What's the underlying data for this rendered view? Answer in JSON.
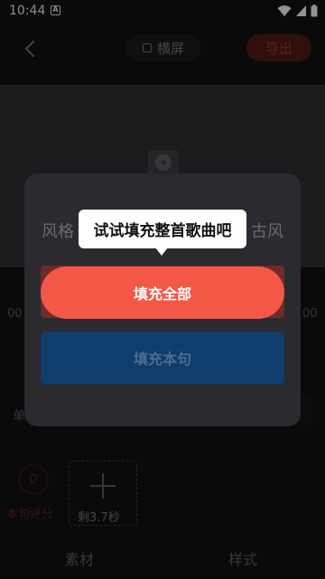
{
  "status_bar": {
    "time": "10:44",
    "notification_glyph": "A"
  },
  "header": {
    "rotate_label": "横屏",
    "export_label": "导出"
  },
  "background": {
    "time_left": "00",
    "time_right": "00",
    "row_label": "单",
    "score_value": "0",
    "score_label": "本句评分",
    "remaining_label": "剩3.7秒",
    "tabs": [
      "素材",
      "样式"
    ]
  },
  "modal": {
    "style_label_left": "风格",
    "style_label_right": "古风",
    "tooltip_text": "试试填充整首歌曲吧",
    "fill_all_label": "填充全部",
    "fill_line_label": "填充本句"
  },
  "colors": {
    "accent": "#f35846",
    "secondary_button": "#113d6d",
    "modal_bg": "#2a2a2f"
  }
}
